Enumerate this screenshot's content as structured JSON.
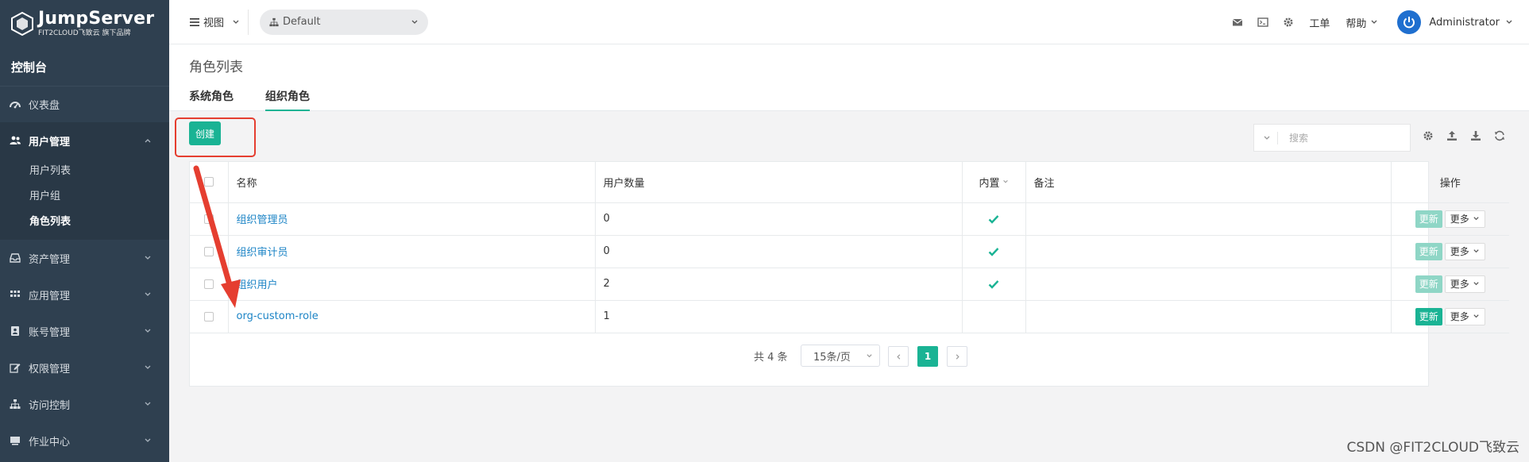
{
  "brand": {
    "logo_title": "JumpServer",
    "logo_subtitle": "FIT2CLOUD飞致云 旗下品牌"
  },
  "sidebar": {
    "console_title": "控制台",
    "items": [
      {
        "label": "仪表盘",
        "icon": "dashboard-icon"
      },
      {
        "label": "用户管理",
        "icon": "users-icon",
        "expanded": true,
        "children": [
          {
            "label": "用户列表"
          },
          {
            "label": "用户组"
          },
          {
            "label": "角色列表",
            "active": true
          }
        ]
      },
      {
        "label": "资产管理",
        "icon": "inbox-icon"
      },
      {
        "label": "应用管理",
        "icon": "grid-icon"
      },
      {
        "label": "账号管理",
        "icon": "account-book-icon"
      },
      {
        "label": "权限管理",
        "icon": "edit-icon"
      },
      {
        "label": "访问控制",
        "icon": "sitemap-icon"
      },
      {
        "label": "作业中心",
        "icon": "terminal-icon"
      }
    ]
  },
  "topbar": {
    "view_label": "视图",
    "org_label": "Default",
    "tickets_label": "工单",
    "help_label": "帮助",
    "user_name": "Administrator"
  },
  "page": {
    "title": "角色列表",
    "tabs": [
      {
        "label": "系统角色",
        "active": false
      },
      {
        "label": "组织角色",
        "active": true
      }
    ]
  },
  "toolbar": {
    "create_label": "创建",
    "search_placeholder": "搜索"
  },
  "table": {
    "headers": {
      "name": "名称",
      "users_amount": "用户数量",
      "builtin": "内置",
      "comment": "备注",
      "actions": "操作"
    },
    "rows": [
      {
        "name": "组织管理员",
        "users_amount": "0",
        "builtin": true,
        "comment": "",
        "update": "更新",
        "more": "更多",
        "update_enabled": false
      },
      {
        "name": "组织审计员",
        "users_amount": "0",
        "builtin": true,
        "comment": "",
        "update": "更新",
        "more": "更多",
        "update_enabled": false
      },
      {
        "name": "组织用户",
        "users_amount": "2",
        "builtin": true,
        "comment": "",
        "update": "更新",
        "more": "更多",
        "update_enabled": false
      },
      {
        "name": "org-custom-role",
        "users_amount": "1",
        "builtin": false,
        "comment": "",
        "update": "更新",
        "more": "更多",
        "update_enabled": true
      }
    ]
  },
  "pagination": {
    "total_label": "共 4 条",
    "page_size_label": "15条/页",
    "current_page": "1"
  },
  "watermark": "CSDN @FIT2CLOUD飞致云",
  "colors": {
    "sidebar_bg": "#2f4050",
    "primary": "#1ab394",
    "link": "#1c84c6",
    "annotation_red": "#e53e30"
  }
}
